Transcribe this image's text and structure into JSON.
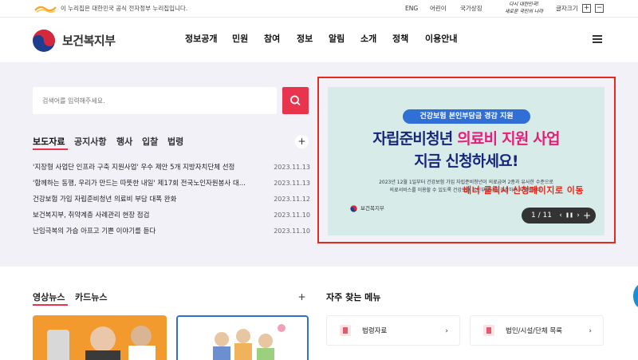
{
  "topbar": {
    "gov_notice": "이 누리집은 대한민국 공식 전자정부 누리집입니다.",
    "eng": "ENG",
    "kids": "어린이",
    "national_symbols": "국가상징",
    "slogan_line1": "다시 대한민국!",
    "slogan_line2": "새로운 국민의 나라",
    "font_size_label": "글자크기",
    "font_plus": "+",
    "font_minus": "−"
  },
  "header": {
    "org_name": "보건복지부",
    "nav": [
      "정보공개",
      "민원",
      "참여",
      "정보",
      "알림",
      "소개",
      "정책",
      "이용안내"
    ]
  },
  "search": {
    "placeholder": "검색어를 입력해주세요."
  },
  "news": {
    "tabs": [
      "보도자료",
      "공지사항",
      "행사",
      "입찰",
      "법령"
    ],
    "active_tab": "보도자료",
    "more": "+",
    "items": [
      {
        "title": "'지장형 사업단 인프라 구축 지원사업' 우수 제안 5개 지방자치단체 선정",
        "date": "2023.11.13"
      },
      {
        "title": "'함께하는 동행, 우리가 만드는 따뜻한 내일' 제17회 전국노인자원봉사 대...",
        "date": "2023.11.13"
      },
      {
        "title": "건강보험 가입 자립준비청년 의료비 부담 대폭 완화",
        "date": "2023.11.12"
      },
      {
        "title": "보건복지부, 취약계층 사례관리 현장 점검",
        "date": "2023.11.10"
      },
      {
        "title": "난임극복의 가슴 아프고 기쁜 이야기를 듣다",
        "date": "2023.11.10"
      }
    ]
  },
  "banner": {
    "pill": "건강보험 본인부담금 경감 지원",
    "headline_part1": "자립준비청년 ",
    "headline_highlight": "의료비 지원 사업",
    "headline_line2": "지금 신청하세요!",
    "sub_line1": "2023년 12월 1일부터 건강보험 가입 자립준비청년이 의료급여 2종과 유사한 수준으로",
    "sub_line2": "의료서비스를 이용할 수 있도록 건강보험 본인부담금을 경감하여 지원합니다.",
    "org": "보건복지부",
    "page_indicator": "1 / 11",
    "prev_icon": "‹",
    "pause_icon": "❚❚",
    "next_icon": "›",
    "add_icon": "+",
    "note": "배너 클릭시 신청페이지로 이동",
    "colors": {
      "pill": "#2f6fd6",
      "headline": "#17267a",
      "highlight": "#e61e78",
      "background": "#d7ece9"
    }
  },
  "media": {
    "tabs": [
      "영상뉴스",
      "카드뉴스"
    ],
    "more": "+"
  },
  "frequent": {
    "title": "자주 찾는 메뉴",
    "items": [
      {
        "label": "법령자료",
        "arrow": "›"
      },
      {
        "label": "법인/시설/단체 목록",
        "arrow": "›"
      }
    ]
  },
  "colors": {
    "accent": "#e8344d",
    "annotation": "#e12b1f",
    "hero_bg": "#f3f1f8"
  }
}
